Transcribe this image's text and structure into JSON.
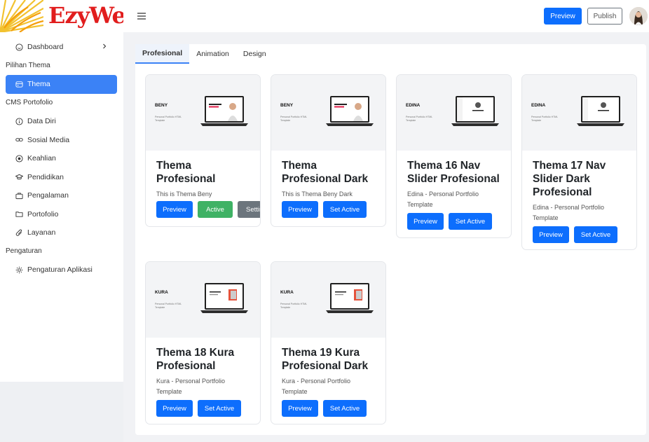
{
  "logo": {
    "text": "EzyWeb"
  },
  "sidebar": {
    "dashboard": {
      "label": "Dashboard",
      "icon": "smile-icon"
    },
    "section_theme": "Pilihan Thema",
    "thema": {
      "label": "Thema",
      "icon": "palette-icon"
    },
    "section_cms": "CMS Portofolio",
    "items": [
      {
        "label": "Data Diri",
        "icon": "info-icon"
      },
      {
        "label": "Sosial Media",
        "icon": "link-icon"
      },
      {
        "label": "Keahlian",
        "icon": "target-icon"
      },
      {
        "label": "Pendidikan",
        "icon": "graduation-cap-icon"
      },
      {
        "label": "Pengalaman",
        "icon": "briefcase-icon"
      },
      {
        "label": "Portofolio",
        "icon": "folder-icon"
      },
      {
        "label": "Layanan",
        "icon": "paperclip-icon"
      }
    ],
    "section_settings": "Pengaturan",
    "settings": {
      "label": "Pengaturan Aplikasi",
      "icon": "gear-icon"
    }
  },
  "topbar": {
    "preview_label": "Preview",
    "publish_label": "Publish"
  },
  "tabs": [
    {
      "label": "Profesional",
      "active": true
    },
    {
      "label": "Animation",
      "active": false
    },
    {
      "label": "Design",
      "active": false
    }
  ],
  "themes": [
    {
      "brand": "BENY",
      "thumb_sub": "Personal Portfolio HTML Template",
      "title": "Thema Profesional",
      "desc": "This is Thema Beny",
      "preview": "Preview",
      "action": "Active",
      "extra": "Settings"
    },
    {
      "brand": "BENY",
      "thumb_sub": "Personal Portfolio HTML Template",
      "title": "Thema Profesional Dark",
      "desc": "This is Thema Beny Dark",
      "preview": "Preview",
      "action": "Set Active"
    },
    {
      "brand": "EDINA",
      "thumb_sub": "Personal Portfolio HTML Template",
      "title": "Thema 16 Nav Slider Profesional",
      "desc": "Edina - Personal Portfolio Template",
      "preview": "Preview",
      "action": "Set Active"
    },
    {
      "brand": "EDINA",
      "thumb_sub": "Personal Portfolio HTML Template",
      "title": "Thema 17 Nav Slider Dark Profesional",
      "desc": "Edina - Personal Portfolio Template",
      "preview": "Preview",
      "action": "Set Active"
    },
    {
      "brand": "KURA",
      "thumb_sub": "Personal Portfolio HTML Template",
      "title": "Thema 18 Kura Profesional",
      "desc": "Kura - Personal Portfolio Template",
      "preview": "Preview",
      "action": "Set Active"
    },
    {
      "brand": "KURA",
      "thumb_sub": "Personal Portfolio HTML Template",
      "title": "Thema 19 Kura Profesional Dark",
      "desc": "Kura - Personal Portfolio Template",
      "preview": "Preview",
      "action": "Set Active"
    }
  ],
  "colors": {
    "primary": "#0d6efd",
    "active_nav": "#3b82f6",
    "success": "#3fb265",
    "secondary": "#6c757d",
    "logo_red": "#e11d1d"
  }
}
